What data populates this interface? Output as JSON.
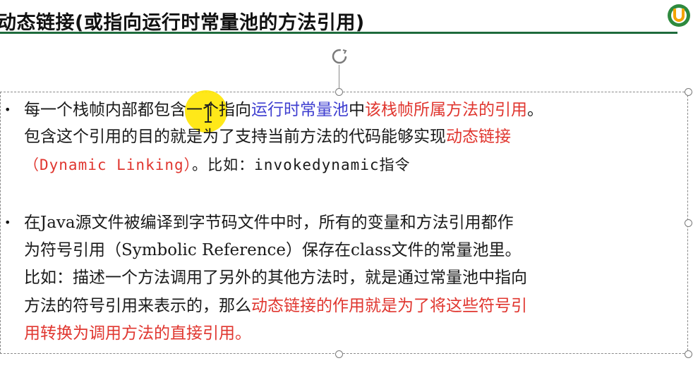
{
  "title": "动态链接(或指向运行时常量池的方法引用)",
  "colors": {
    "accent_green": "#1e6b3c",
    "blue_text": "#3f3fd0",
    "red_text": "#e0362f",
    "pointer_yellow": "#ffe600"
  },
  "bullet1": {
    "line1_a": "每一个栈帧内部都包含一个指向",
    "line1_b": "运行时常量池",
    "line1_c": "中",
    "line1_d": "该栈帧所属方法的引用",
    "line1_e": "。",
    "line2_a": "包含这个引用的目的就是为了支持当前方法的代码能够实现",
    "line2_b": "动态链接",
    "line3_a": "（Dynamic Linking）",
    "line3_b": "。比如：invokedynamic指令"
  },
  "bullet2": {
    "line1": "在Java源文件被编译到字节码文件中时，所有的变量和方法引用都作",
    "line2": "为符号引用（Symbolic Reference）保存在class文件的常量池里。",
    "line3": "比如：描述一个方法调用了另外的其他方法时，就是通过常量池中指向",
    "line4_a": "方法的符号引用来表示的，那么",
    "line4_b": "动态链接的作用就是为了将这些符号引",
    "line5_a": "用转换为调用方法的直接引用",
    "line5_b": "。"
  },
  "icons": [
    "logo-icon",
    "rotate-handle-icon",
    "text-cursor-icon"
  ]
}
